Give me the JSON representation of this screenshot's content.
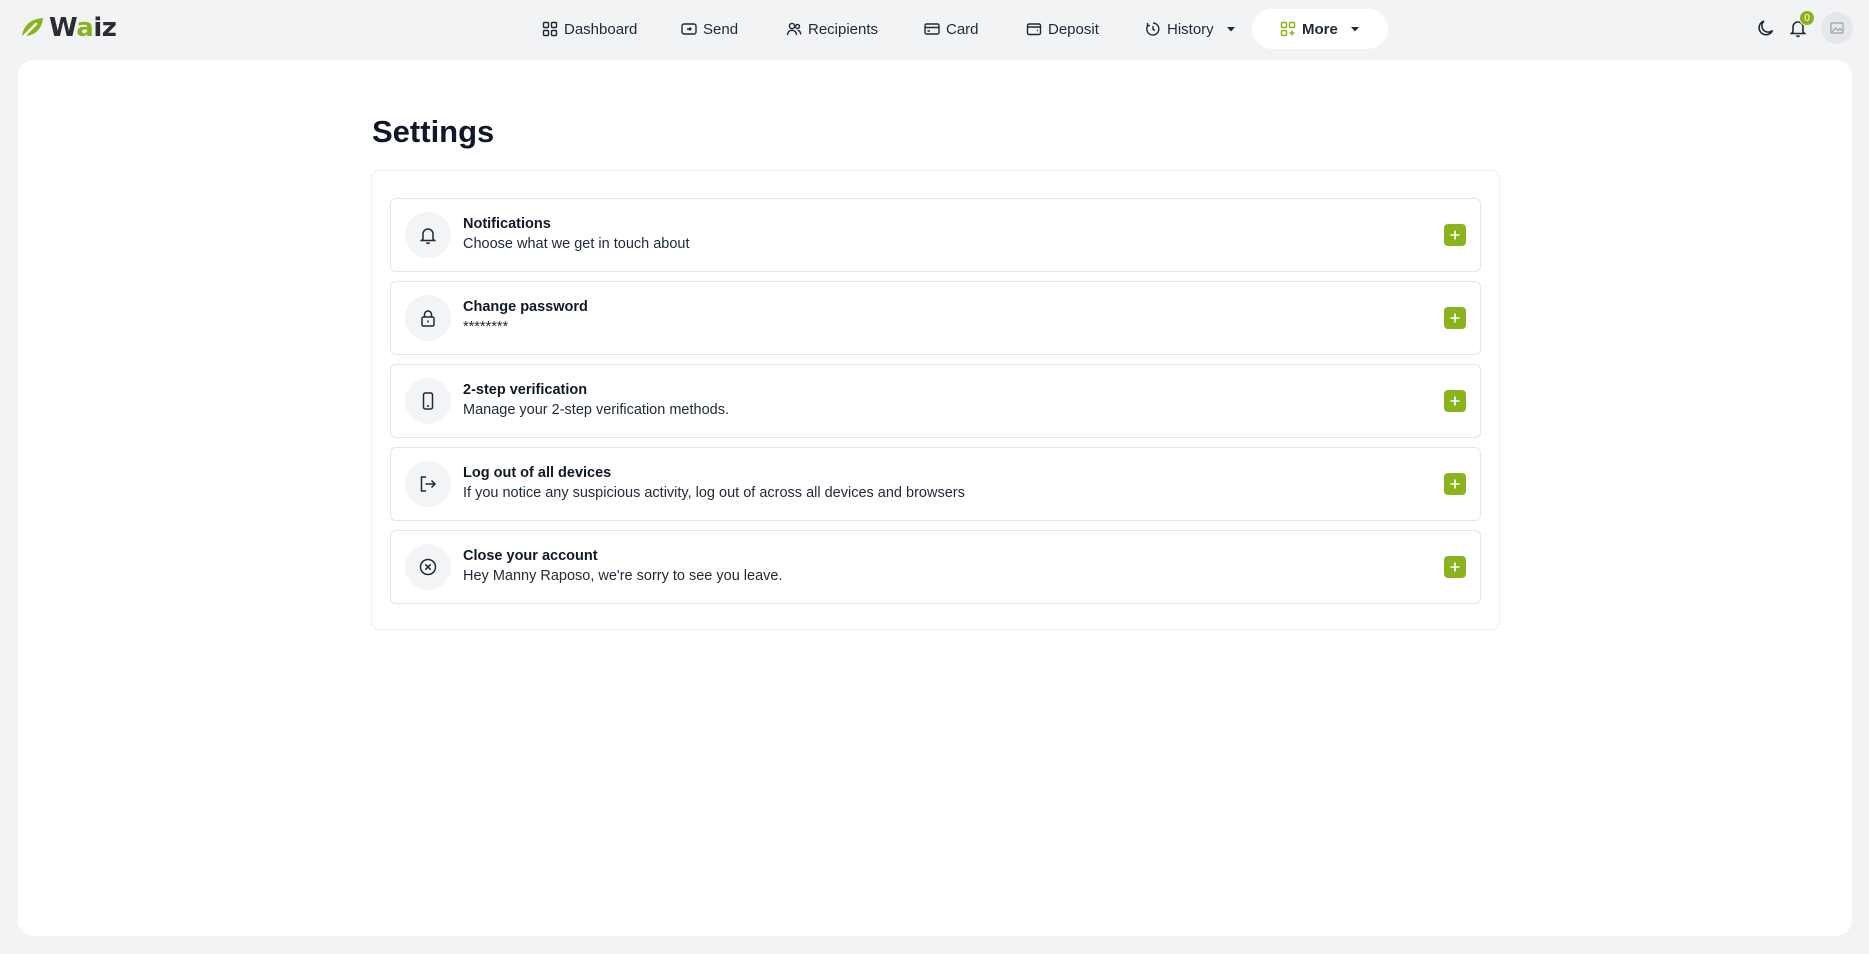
{
  "brand": {
    "name_prefix": "W",
    "name_accent": "a",
    "name_suffix": "iz",
    "accent_color": "#8ab31e"
  },
  "nav": {
    "items": [
      {
        "label": "Dashboard",
        "icon": "grid-icon"
      },
      {
        "label": "Send",
        "icon": "send-icon"
      },
      {
        "label": "Recipients",
        "icon": "users-icon"
      },
      {
        "label": "Card",
        "icon": "card-icon"
      },
      {
        "label": "Deposit",
        "icon": "wallet-icon"
      },
      {
        "label": "History",
        "icon": "history-icon",
        "has_dropdown": true
      },
      {
        "label": "More",
        "icon": "apps-icon",
        "has_dropdown": true,
        "active": true
      }
    ]
  },
  "header_actions": {
    "theme_icon": "moon-icon",
    "notifications_icon": "bell-icon",
    "notifications_count": "0",
    "avatar_icon": "image-placeholder-icon"
  },
  "page": {
    "title": "Settings"
  },
  "settings": [
    {
      "title": "Notifications",
      "subtitle": "Choose what we get in touch about",
      "icon": "bell-icon"
    },
    {
      "title": "Change password",
      "subtitle": "********",
      "icon": "lock-icon"
    },
    {
      "title": "2-step verification",
      "subtitle": "Manage your 2-step verification methods.",
      "icon": "smartphone-icon"
    },
    {
      "title": "Log out of all devices",
      "subtitle": "If you notice any suspicious activity, log out of across all devices and browsers",
      "icon": "logout-icon"
    },
    {
      "title": "Close your account",
      "subtitle": "Hey Manny Raposo, we're sorry to see you leave.",
      "icon": "close-circle-icon"
    }
  ]
}
